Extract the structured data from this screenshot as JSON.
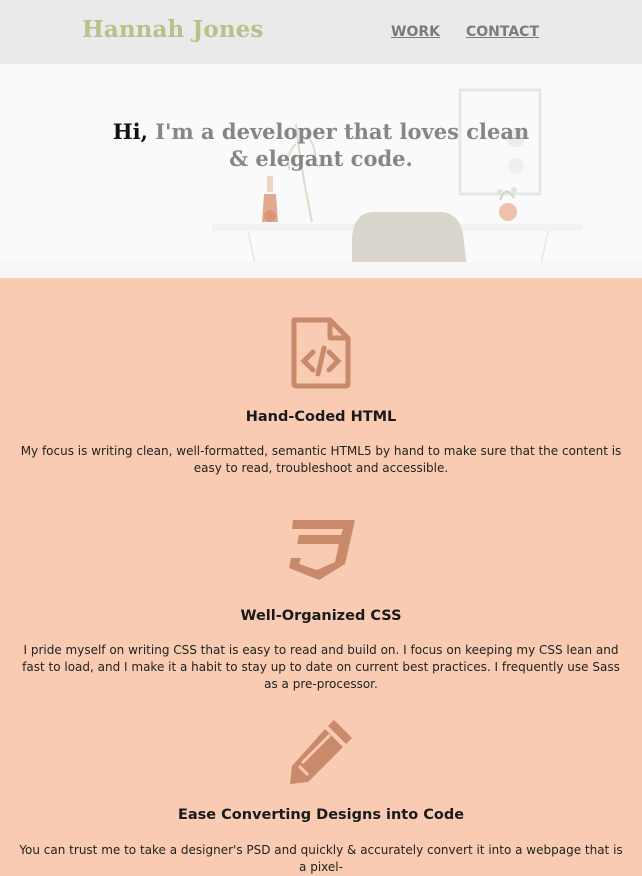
{
  "header": {
    "logo": "Hannah Jones",
    "nav": [
      "WORK",
      "CONTACT"
    ]
  },
  "hero": {
    "greeting": "Hi,",
    "tagline": "I'm a developer that loves clean & elegant code."
  },
  "features": [
    {
      "icon": "html-file-icon",
      "title": "Hand-Coded HTML",
      "text": "My focus is writing clean, well-formatted, semantic HTML5 by hand to make sure that the content is easy to read, troubleshoot and accessible."
    },
    {
      "icon": "css3-icon",
      "title": "Well-Organized CSS",
      "text": "I pride myself on writing CSS that is easy to read and build on. I focus on keeping my CSS lean and fast to load, and I make it a habit to stay up to date on current best practices. I frequently use Sass as a pre-processor."
    },
    {
      "icon": "pencil-icon",
      "title": "Ease Converting Designs into Code",
      "text": "You can trust me to take a designer's PSD and quickly & accurately convert it into a webpage that is a pixel-"
    }
  ],
  "colors": {
    "header_bg": "#eaeaea",
    "logo": "#b9c08a",
    "accent_bg": "#f8cbb2",
    "icon": "#c98a6c"
  }
}
